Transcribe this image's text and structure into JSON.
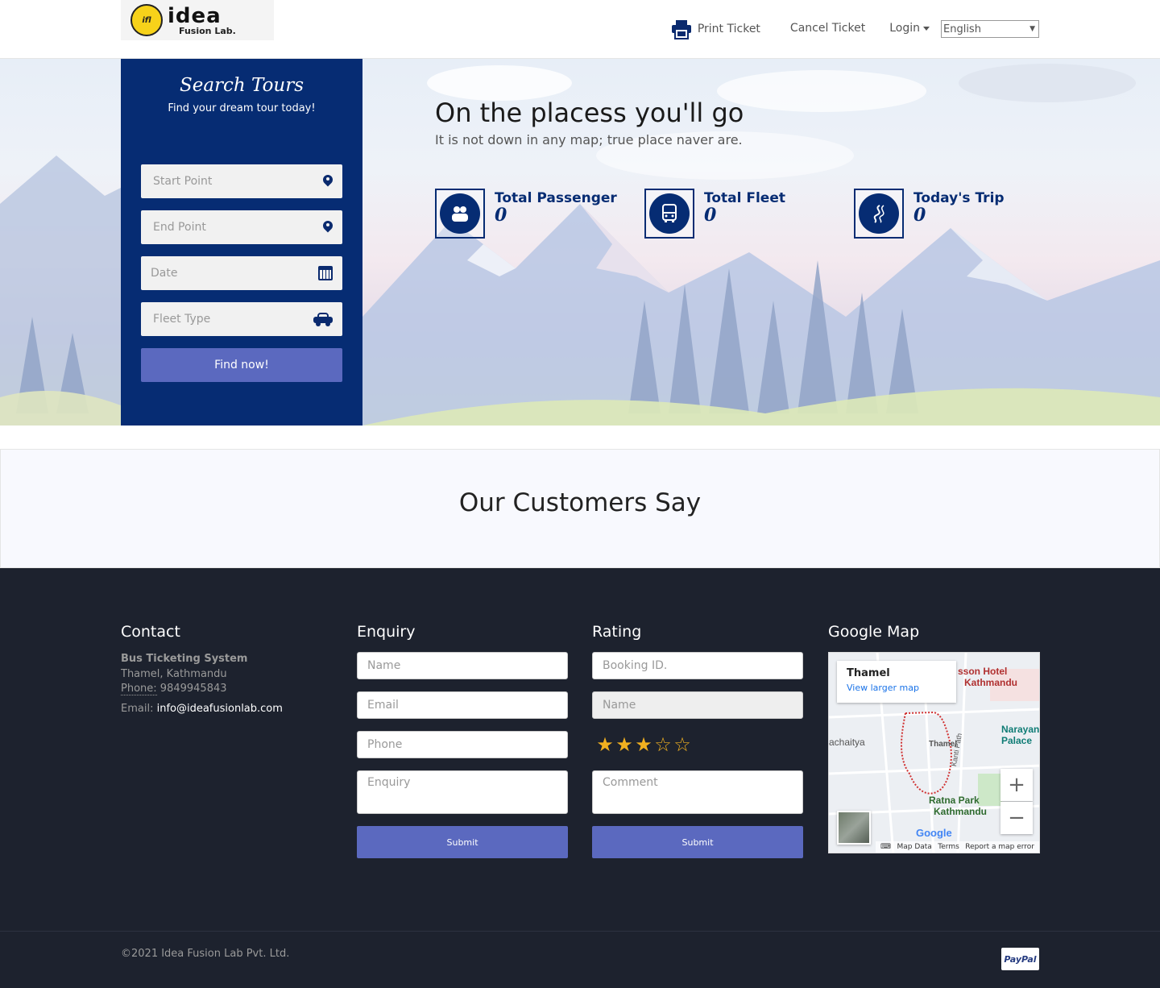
{
  "header": {
    "logo": {
      "main": "idea",
      "sub": "Fusion Lab.",
      "badge": "ifl"
    },
    "nav": {
      "print_ticket": "Print Ticket",
      "cancel_ticket": "Cancel Ticket",
      "login": "Login",
      "language": "English"
    }
  },
  "search": {
    "title": "Search Tours",
    "subtitle": "Find your dream tour today!",
    "start_point": "Start Point",
    "end_point": "End Point",
    "date": "Date",
    "fleet_type": "Fleet Type",
    "find_button": "Find now!"
  },
  "hero": {
    "title": "On the placess you'll go",
    "subtitle": "It is not down in any map; true place naver are.",
    "stats": [
      {
        "label": "Total Passenger",
        "value": "0",
        "icon": "users-icon"
      },
      {
        "label": "Total Fleet",
        "value": "0",
        "icon": "bus-icon"
      },
      {
        "label": "Today's Trip",
        "value": "0",
        "icon": "road-icon"
      }
    ]
  },
  "testimonials": {
    "title": "Our Customers Say"
  },
  "footer": {
    "contact": {
      "title": "Contact",
      "company": "Bus Ticketing System",
      "address": "Thamel, Kathmandu",
      "phone_label": "Phone:",
      "phone": "9849945843",
      "email_label": "Email:",
      "email": "info@ideafusionlab.com"
    },
    "enquiry": {
      "title": "Enquiry",
      "name": "Name",
      "email": "Email",
      "phone": "Phone",
      "enquiry": "Enquiry",
      "submit": "Submit"
    },
    "rating": {
      "title": "Rating",
      "booking_id": "Booking ID.",
      "name": "Name",
      "stars": 3,
      "max_stars": 5,
      "comment": "Comment",
      "submit": "Submit"
    },
    "map": {
      "title": "Google Map",
      "place": "Thamel",
      "view_larger": "View larger map",
      "labels": [
        "Thamel",
        "Ratna Park",
        "Kathmandu",
        "Narayan",
        "Palace",
        "Kanti Path",
        "achaitya",
        "sson Hotel",
        "Kathmandu"
      ],
      "map_data": "Map Data",
      "terms": "Terms",
      "report": "Report a map error",
      "google": "Google"
    },
    "copyright": "©2021 Idea Fusion Lab Pvt. Ltd.",
    "payment": "PayPal"
  },
  "colors": {
    "primary": "#062c73",
    "button": "#5b69bf",
    "footer_bg": "#1d222e",
    "star": "#f0b020"
  }
}
